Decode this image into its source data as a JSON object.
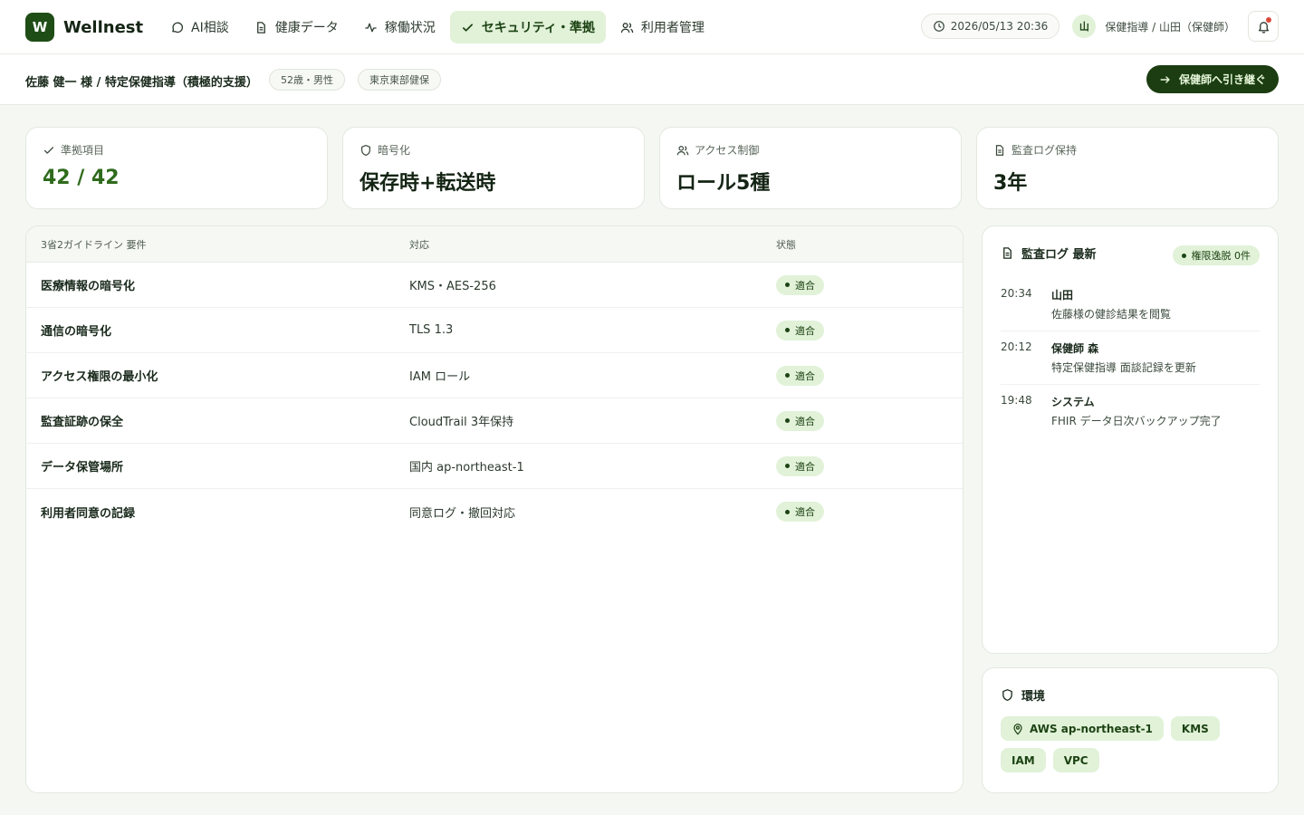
{
  "app": {
    "logo_letter": "W",
    "name": "Wellnest"
  },
  "nav": [
    {
      "label": "AI相談",
      "icon": "chat-icon"
    },
    {
      "label": "健康データ",
      "icon": "document-icon"
    },
    {
      "label": "稼働状況",
      "icon": "activity-icon"
    },
    {
      "label": "セキュリティ・準拠",
      "icon": "check-icon",
      "active": true
    },
    {
      "label": "利用者管理",
      "icon": "users-icon"
    }
  ],
  "header": {
    "datetime": "2026/05/13 20:36",
    "user_initial": "山",
    "user_label": "保健指導 / 山田（保健師）"
  },
  "subbar": {
    "patient": "佐藤 健一 様 / 特定保健指導（積極的支援）",
    "chip_age": "52歳・男性",
    "chip_insurer": "東京東部健保",
    "handoff_label": "保健師へ引き継ぐ"
  },
  "stats": [
    {
      "label": "準拠項目",
      "value": "42 / 42",
      "icon": "check-icon"
    },
    {
      "label": "暗号化",
      "value": "保存時+転送時",
      "icon": "shield-icon"
    },
    {
      "label": "アクセス制御",
      "value": "ロール5種",
      "icon": "users-icon"
    },
    {
      "label": "監査ログ保持",
      "value": "3年",
      "icon": "document-icon"
    }
  ],
  "table": {
    "headers": [
      "3省2ガイドライン 要件",
      "対応",
      "状態"
    ],
    "rows": [
      {
        "req": "医療情報の暗号化",
        "impl": "KMS・AES-256",
        "status": "適合"
      },
      {
        "req": "通信の暗号化",
        "impl": "TLS 1.3",
        "status": "適合"
      },
      {
        "req": "アクセス権限の最小化",
        "impl": "IAM ロール",
        "status": "適合"
      },
      {
        "req": "監査証跡の保全",
        "impl": "CloudTrail 3年保持",
        "status": "適合"
      },
      {
        "req": "データ保管場所",
        "impl": "国内 ap-northeast-1",
        "status": "適合"
      },
      {
        "req": "利用者同意の記録",
        "impl": "同意ログ・撤回対応",
        "status": "適合"
      }
    ]
  },
  "audit": {
    "title": "監査ログ 最新",
    "badge": "権限逸脱 0件",
    "items": [
      {
        "time": "20:34",
        "who": "山田",
        "what": "佐藤様の健診結果を閲覧"
      },
      {
        "time": "20:12",
        "who": "保健師 森",
        "what": "特定保健指導 面談記録を更新"
      },
      {
        "time": "19:48",
        "who": "システム",
        "what": "FHIR データ日次バックアップ完了"
      }
    ]
  },
  "env": {
    "title": "環境",
    "tags": [
      "AWS ap-northeast-1",
      "KMS",
      "IAM",
      "VPC"
    ]
  },
  "colors": {
    "accent": "#1f4d16",
    "accent_light": "#e1f2d8",
    "stat_green": "#2f6b1d"
  }
}
